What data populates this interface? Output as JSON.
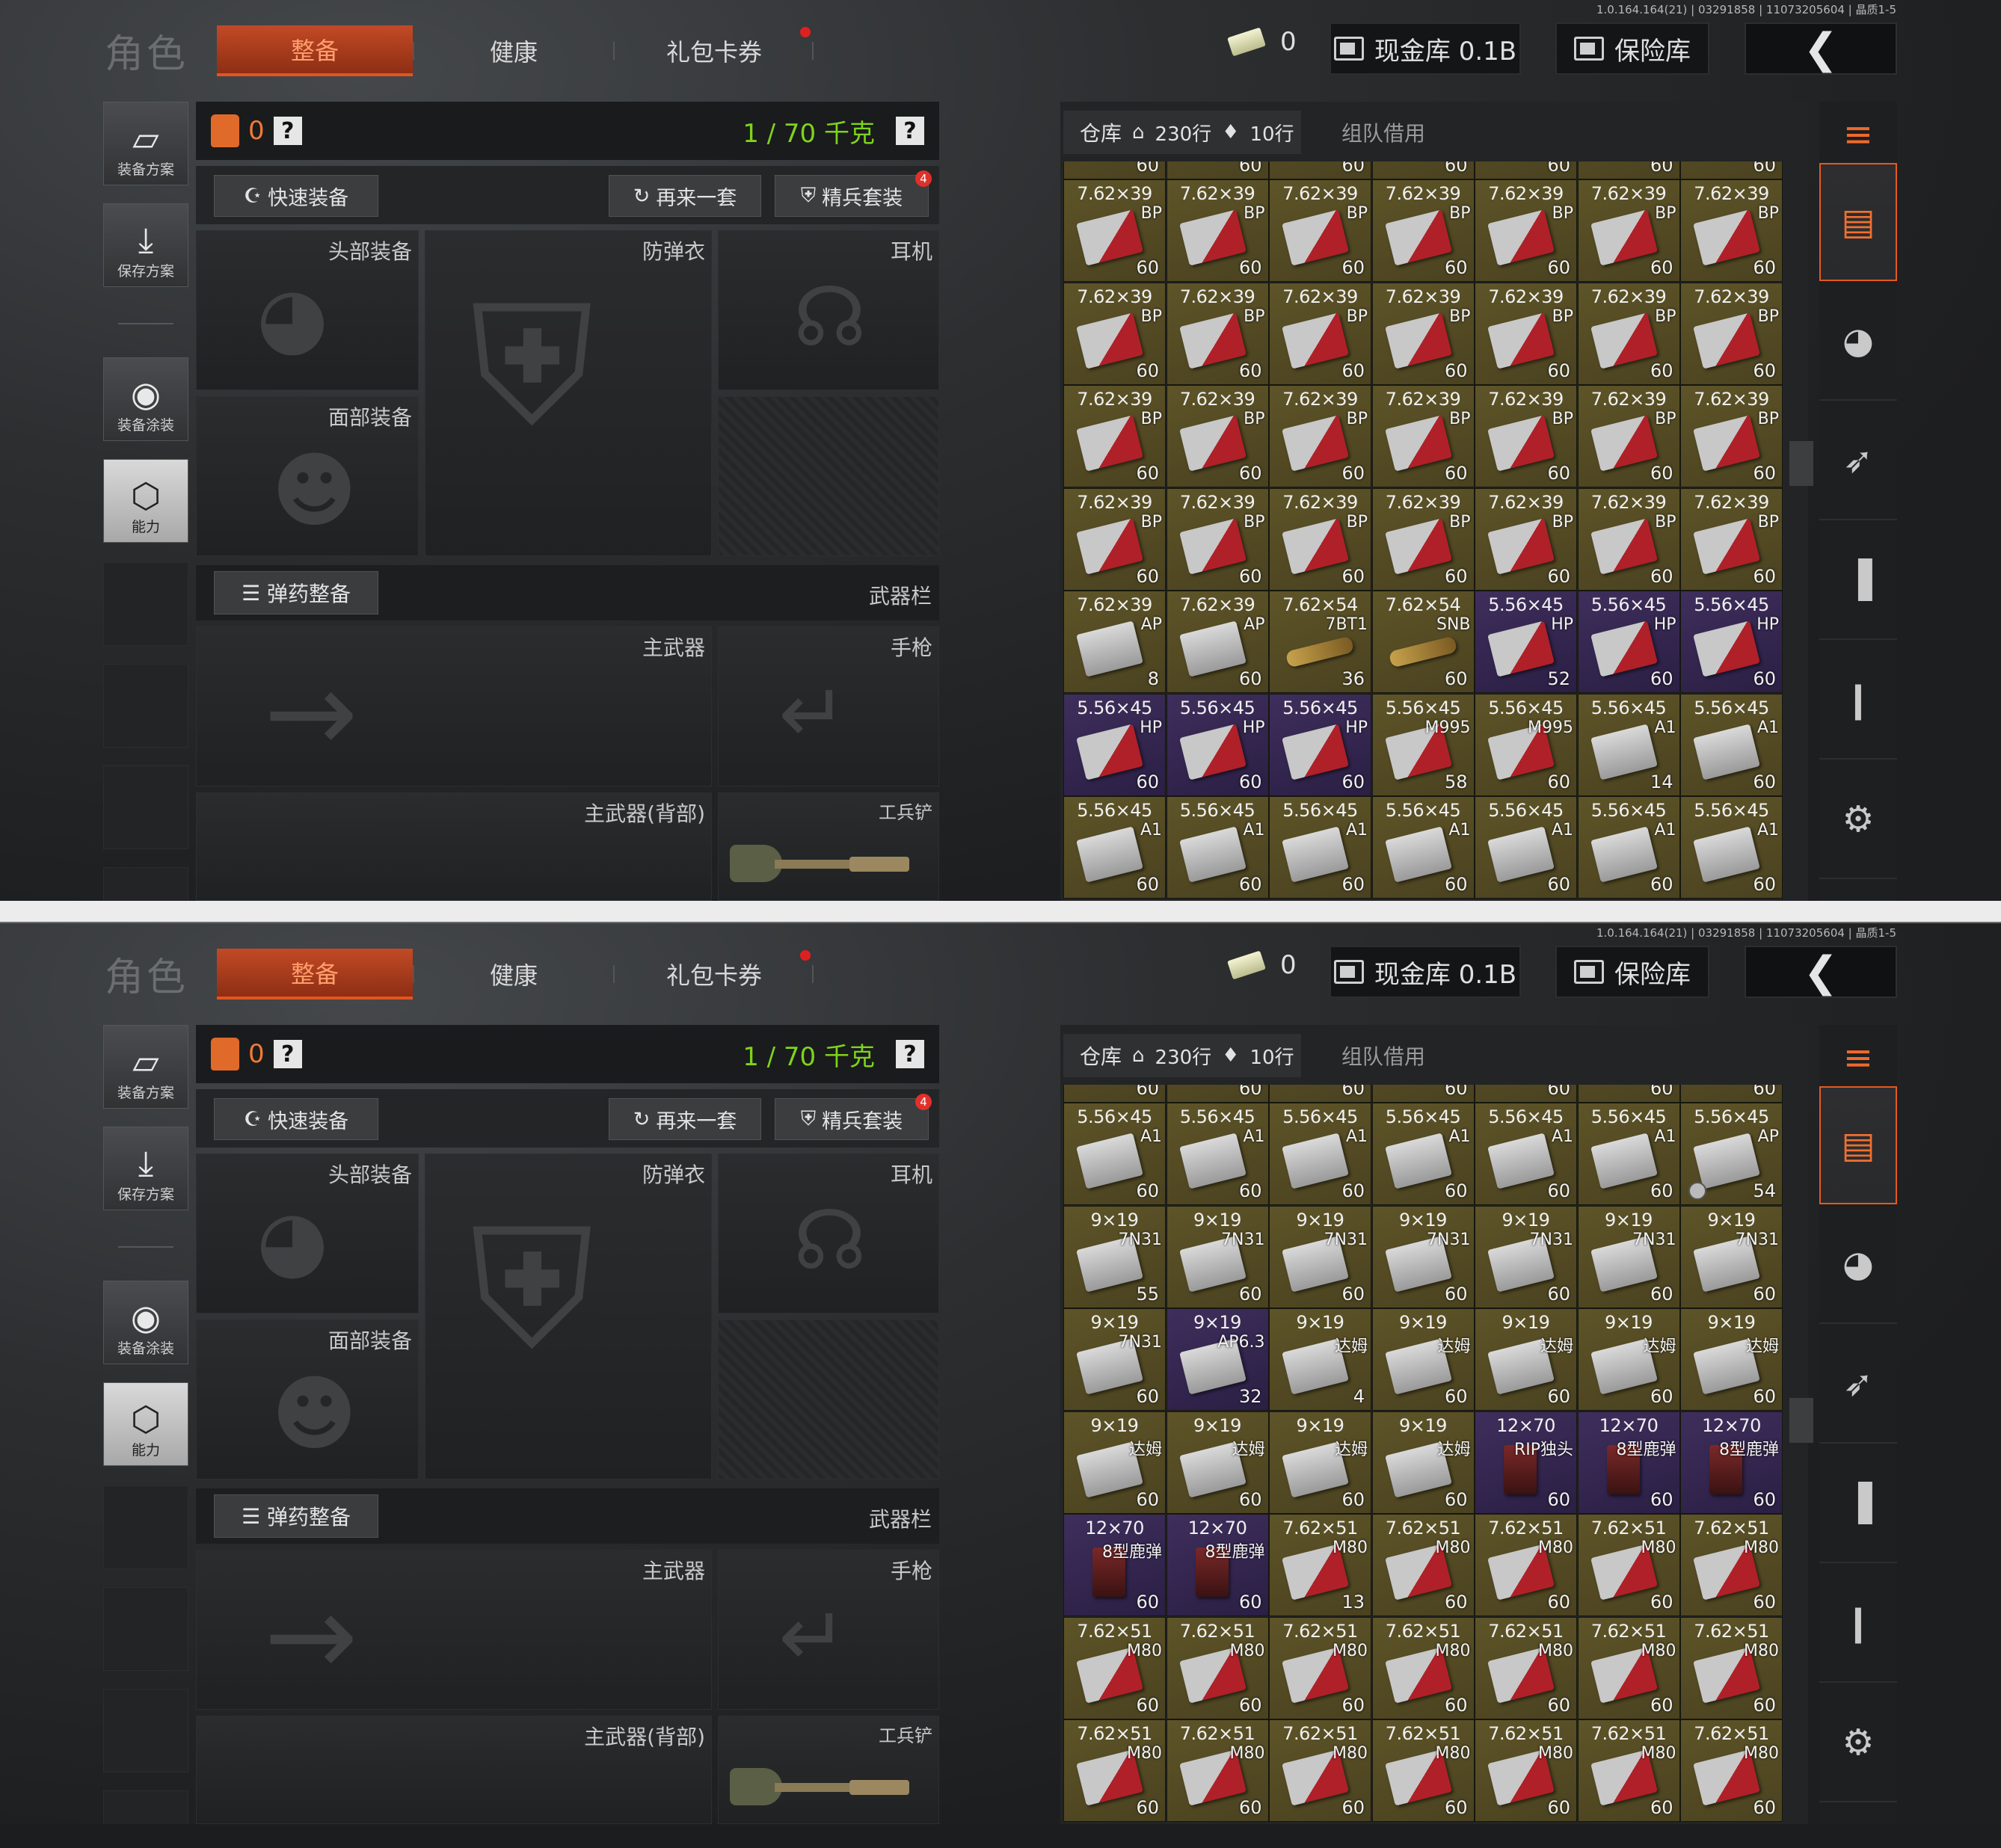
{
  "version": "1.0.164.164(21) | 03291858 | 11073205604 | 晶质1-5",
  "header": {
    "role_label": "角色",
    "tabs": [
      "整备",
      "健康",
      "礼包卡券"
    ],
    "cash_amount": "0",
    "cash_vault_label": "现金库 0.1B",
    "safe_label": "保险库",
    "back_icon": "chevron-left-icon"
  },
  "sidebar": {
    "items": [
      {
        "label": "装备方案",
        "icon": "vest-plan-icon"
      },
      {
        "label": "保存方案",
        "icon": "download-icon"
      },
      {
        "label": "装备涂装",
        "icon": "helmet-skin-icon"
      },
      {
        "label": "能力",
        "icon": "lightning-hex-icon"
      }
    ]
  },
  "equipment": {
    "armor_count": "0",
    "help": "?",
    "weight": "1 / 70 千克",
    "quick_equip": "快速装备",
    "repeat_set": "再来一套",
    "elite_set": "精兵套装",
    "elite_badge": "4",
    "slots": {
      "head": "头部装备",
      "armor": "防弹衣",
      "headset": "耳机",
      "face": "面部装备",
      "primary": "主武器",
      "pistol": "手枪",
      "primary_back": "主武器(背部)",
      "shovel": "工兵铲"
    },
    "ammo_sort": "弹药整备",
    "weapon_bar": "武器栏"
  },
  "inventory": {
    "tab_label": "仓库",
    "rows": "230行",
    "tag_rows": "10行",
    "team_borrow": "组队借用",
    "right_icons": [
      "inventory-sort-icon",
      "ammo-box-icon",
      "helmet-icon",
      "rifle-icon",
      "magazine-icon",
      "bullet-icon",
      "gear-icon"
    ],
    "panels": [
      {
        "top_counts": [
          "60",
          "60",
          "60",
          "60",
          "60",
          "60",
          "60"
        ],
        "cells": [
          {
            "cal": "7.62×39",
            "var": "BP",
            "cnt": "60",
            "c": "brown",
            "b": "red"
          },
          {
            "cal": "7.62×39",
            "var": "BP",
            "cnt": "60",
            "c": "brown",
            "b": "red"
          },
          {
            "cal": "7.62×39",
            "var": "BP",
            "cnt": "60",
            "c": "brown",
            "b": "red"
          },
          {
            "cal": "7.62×39",
            "var": "BP",
            "cnt": "60",
            "c": "brown",
            "b": "red"
          },
          {
            "cal": "7.62×39",
            "var": "BP",
            "cnt": "60",
            "c": "brown",
            "b": "red"
          },
          {
            "cal": "7.62×39",
            "var": "BP",
            "cnt": "60",
            "c": "brown",
            "b": "red"
          },
          {
            "cal": "7.62×39",
            "var": "BP",
            "cnt": "60",
            "c": "brown",
            "b": "red"
          },
          {
            "cal": "7.62×39",
            "var": "BP",
            "cnt": "60",
            "c": "brown",
            "b": "red"
          },
          {
            "cal": "7.62×39",
            "var": "BP",
            "cnt": "60",
            "c": "brown",
            "b": "red"
          },
          {
            "cal": "7.62×39",
            "var": "BP",
            "cnt": "60",
            "c": "brown",
            "b": "red"
          },
          {
            "cal": "7.62×39",
            "var": "BP",
            "cnt": "60",
            "c": "brown",
            "b": "red"
          },
          {
            "cal": "7.62×39",
            "var": "BP",
            "cnt": "60",
            "c": "brown",
            "b": "red"
          },
          {
            "cal": "7.62×39",
            "var": "BP",
            "cnt": "60",
            "c": "brown",
            "b": "red"
          },
          {
            "cal": "7.62×39",
            "var": "BP",
            "cnt": "60",
            "c": "brown",
            "b": "red"
          },
          {
            "cal": "7.62×39",
            "var": "BP",
            "cnt": "60",
            "c": "brown",
            "b": "red"
          },
          {
            "cal": "7.62×39",
            "var": "BP",
            "cnt": "60",
            "c": "brown",
            "b": "red"
          },
          {
            "cal": "7.62×39",
            "var": "BP",
            "cnt": "60",
            "c": "brown",
            "b": "red"
          },
          {
            "cal": "7.62×39",
            "var": "BP",
            "cnt": "60",
            "c": "brown",
            "b": "red"
          },
          {
            "cal": "7.62×39",
            "var": "BP",
            "cnt": "60",
            "c": "brown",
            "b": "red"
          },
          {
            "cal": "7.62×39",
            "var": "BP",
            "cnt": "60",
            "c": "brown",
            "b": "red"
          },
          {
            "cal": "7.62×39",
            "var": "BP",
            "cnt": "60",
            "c": "brown",
            "b": "red"
          },
          {
            "cal": "7.62×39",
            "var": "BP",
            "cnt": "60",
            "c": "brown",
            "b": "red"
          },
          {
            "cal": "7.62×39",
            "var": "BP",
            "cnt": "60",
            "c": "brown",
            "b": "red"
          },
          {
            "cal": "7.62×39",
            "var": "BP",
            "cnt": "60",
            "c": "brown",
            "b": "red"
          },
          {
            "cal": "7.62×39",
            "var": "BP",
            "cnt": "60",
            "c": "brown",
            "b": "red"
          },
          {
            "cal": "7.62×39",
            "var": "BP",
            "cnt": "60",
            "c": "brown",
            "b": "red"
          },
          {
            "cal": "7.62×39",
            "var": "BP",
            "cnt": "60",
            "c": "brown",
            "b": "red"
          },
          {
            "cal": "7.62×39",
            "var": "BP",
            "cnt": "60",
            "c": "brown",
            "b": "red"
          },
          {
            "cal": "7.62×39",
            "var": "AP",
            "cnt": "8",
            "c": "brown",
            "b": ""
          },
          {
            "cal": "7.62×39",
            "var": "AP",
            "cnt": "60",
            "c": "brown",
            "b": ""
          },
          {
            "cal": "7.62×54",
            "var": "7BT1",
            "cnt": "36",
            "c": "brown",
            "b": "cart"
          },
          {
            "cal": "7.62×54",
            "var": "SNB",
            "cnt": "60",
            "c": "brown",
            "b": "cart"
          },
          {
            "cal": "5.56×45",
            "var": "HP",
            "cnt": "52",
            "c": "purple",
            "b": "red"
          },
          {
            "cal": "5.56×45",
            "var": "HP",
            "cnt": "60",
            "c": "purple",
            "b": "red"
          },
          {
            "cal": "5.56×45",
            "var": "HP",
            "cnt": "60",
            "c": "purple",
            "b": "red"
          },
          {
            "cal": "5.56×45",
            "var": "HP",
            "cnt": "60",
            "c": "purple",
            "b": "red"
          },
          {
            "cal": "5.56×45",
            "var": "HP",
            "cnt": "60",
            "c": "purple",
            "b": "red"
          },
          {
            "cal": "5.56×45",
            "var": "HP",
            "cnt": "60",
            "c": "purple",
            "b": "red"
          },
          {
            "cal": "5.56×45",
            "var": "M995",
            "cnt": "58",
            "c": "brown",
            "b": "red"
          },
          {
            "cal": "5.56×45",
            "var": "M995",
            "cnt": "60",
            "c": "brown",
            "b": "red"
          },
          {
            "cal": "5.56×45",
            "var": "A1",
            "cnt": "14",
            "c": "brown",
            "b": ""
          },
          {
            "cal": "5.56×45",
            "var": "A1",
            "cnt": "60",
            "c": "brown",
            "b": ""
          },
          {
            "cal": "5.56×45",
            "var": "A1",
            "cnt": "60",
            "c": "brown",
            "b": ""
          },
          {
            "cal": "5.56×45",
            "var": "A1",
            "cnt": "60",
            "c": "brown",
            "b": ""
          },
          {
            "cal": "5.56×45",
            "var": "A1",
            "cnt": "60",
            "c": "brown",
            "b": ""
          },
          {
            "cal": "5.56×45",
            "var": "A1",
            "cnt": "60",
            "c": "brown",
            "b": ""
          },
          {
            "cal": "5.56×45",
            "var": "A1",
            "cnt": "60",
            "c": "brown",
            "b": ""
          },
          {
            "cal": "5.56×45",
            "var": "A1",
            "cnt": "60",
            "c": "brown",
            "b": ""
          },
          {
            "cal": "5.56×45",
            "var": "A1",
            "cnt": "60",
            "c": "brown",
            "b": ""
          }
        ]
      },
      {
        "top_counts": [
          "60",
          "60",
          "60",
          "60",
          "60",
          "60",
          "60"
        ],
        "cells": [
          {
            "cal": "5.56×45",
            "var": "A1",
            "cnt": "60",
            "c": "brown",
            "b": ""
          },
          {
            "cal": "5.56×45",
            "var": "A1",
            "cnt": "60",
            "c": "brown",
            "b": ""
          },
          {
            "cal": "5.56×45",
            "var": "A1",
            "cnt": "60",
            "c": "brown",
            "b": ""
          },
          {
            "cal": "5.56×45",
            "var": "A1",
            "cnt": "60",
            "c": "brown",
            "b": ""
          },
          {
            "cal": "5.56×45",
            "var": "A1",
            "cnt": "60",
            "c": "brown",
            "b": ""
          },
          {
            "cal": "5.56×45",
            "var": "A1",
            "cnt": "60",
            "c": "brown",
            "b": ""
          },
          {
            "cal": "5.56×45",
            "var": "AP",
            "cnt": "54",
            "c": "brown",
            "b": "",
            "mark": true
          },
          {
            "cal": "9×19",
            "var": "7N31",
            "cnt": "55",
            "c": "brown",
            "b": ""
          },
          {
            "cal": "9×19",
            "var": "7N31",
            "cnt": "60",
            "c": "brown",
            "b": ""
          },
          {
            "cal": "9×19",
            "var": "7N31",
            "cnt": "60",
            "c": "brown",
            "b": ""
          },
          {
            "cal": "9×19",
            "var": "7N31",
            "cnt": "60",
            "c": "brown",
            "b": ""
          },
          {
            "cal": "9×19",
            "var": "7N31",
            "cnt": "60",
            "c": "brown",
            "b": ""
          },
          {
            "cal": "9×19",
            "var": "7N31",
            "cnt": "60",
            "c": "brown",
            "b": ""
          },
          {
            "cal": "9×19",
            "var": "7N31",
            "cnt": "60",
            "c": "brown",
            "b": ""
          },
          {
            "cal": "9×19",
            "var": "7N31",
            "cnt": "60",
            "c": "brown",
            "b": ""
          },
          {
            "cal": "9×19",
            "var": "AP6.3",
            "cnt": "32",
            "c": "purple",
            "b": ""
          },
          {
            "cal": "9×19",
            "var": "达姆",
            "cnt": "4",
            "c": "brown",
            "b": ""
          },
          {
            "cal": "9×19",
            "var": "达姆",
            "cnt": "60",
            "c": "brown",
            "b": ""
          },
          {
            "cal": "9×19",
            "var": "达姆",
            "cnt": "60",
            "c": "brown",
            "b": ""
          },
          {
            "cal": "9×19",
            "var": "达姆",
            "cnt": "60",
            "c": "brown",
            "b": ""
          },
          {
            "cal": "9×19",
            "var": "达姆",
            "cnt": "60",
            "c": "brown",
            "b": ""
          },
          {
            "cal": "9×19",
            "var": "达姆",
            "cnt": "60",
            "c": "brown",
            "b": ""
          },
          {
            "cal": "9×19",
            "var": "达姆",
            "cnt": "60",
            "c": "brown",
            "b": ""
          },
          {
            "cal": "9×19",
            "var": "达姆",
            "cnt": "60",
            "c": "brown",
            "b": ""
          },
          {
            "cal": "9×19",
            "var": "达姆",
            "cnt": "60",
            "c": "brown",
            "b": ""
          },
          {
            "cal": "12×70",
            "var": "RIP独头",
            "cnt": "60",
            "c": "purple",
            "b": "shell"
          },
          {
            "cal": "12×70",
            "var": "8型鹿弹",
            "cnt": "60",
            "c": "purple",
            "b": "shell"
          },
          {
            "cal": "12×70",
            "var": "8型鹿弹",
            "cnt": "60",
            "c": "purple",
            "b": "shell"
          },
          {
            "cal": "12×70",
            "var": "8型鹿弹",
            "cnt": "60",
            "c": "purple",
            "b": "shell"
          },
          {
            "cal": "12×70",
            "var": "8型鹿弹",
            "cnt": "60",
            "c": "purple",
            "b": "shell"
          },
          {
            "cal": "7.62×51",
            "var": "M80",
            "cnt": "13",
            "c": "brown",
            "b": "red"
          },
          {
            "cal": "7.62×51",
            "var": "M80",
            "cnt": "60",
            "c": "brown",
            "b": "red"
          },
          {
            "cal": "7.62×51",
            "var": "M80",
            "cnt": "60",
            "c": "brown",
            "b": "red"
          },
          {
            "cal": "7.62×51",
            "var": "M80",
            "cnt": "60",
            "c": "brown",
            "b": "red"
          },
          {
            "cal": "7.62×51",
            "var": "M80",
            "cnt": "60",
            "c": "brown",
            "b": "red"
          },
          {
            "cal": "7.62×51",
            "var": "M80",
            "cnt": "60",
            "c": "brown",
            "b": "red"
          },
          {
            "cal": "7.62×51",
            "var": "M80",
            "cnt": "60",
            "c": "brown",
            "b": "red"
          },
          {
            "cal": "7.62×51",
            "var": "M80",
            "cnt": "60",
            "c": "brown",
            "b": "red"
          },
          {
            "cal": "7.62×51",
            "var": "M80",
            "cnt": "60",
            "c": "brown",
            "b": "red"
          },
          {
            "cal": "7.62×51",
            "var": "M80",
            "cnt": "60",
            "c": "brown",
            "b": "red"
          },
          {
            "cal": "7.62×51",
            "var": "M80",
            "cnt": "60",
            "c": "brown",
            "b": "red"
          },
          {
            "cal": "7.62×51",
            "var": "M80",
            "cnt": "60",
            "c": "brown",
            "b": "red"
          },
          {
            "cal": "7.62×51",
            "var": "M80",
            "cnt": "60",
            "c": "brown",
            "b": "red"
          },
          {
            "cal": "7.62×51",
            "var": "M80",
            "cnt": "60",
            "c": "brown",
            "b": "red"
          },
          {
            "cal": "7.62×51",
            "var": "M80",
            "cnt": "60",
            "c": "brown",
            "b": "red"
          },
          {
            "cal": "7.62×51",
            "var": "M80",
            "cnt": "60",
            "c": "brown",
            "b": "red"
          },
          {
            "cal": "7.62×51",
            "var": "M80",
            "cnt": "60",
            "c": "brown",
            "b": "red"
          },
          {
            "cal": "7.62×51",
            "var": "M80",
            "cnt": "60",
            "c": "brown",
            "b": "red"
          },
          {
            "cal": "7.62×51",
            "var": "M80",
            "cnt": "60",
            "c": "brown",
            "b": "red"
          }
        ]
      }
    ]
  }
}
